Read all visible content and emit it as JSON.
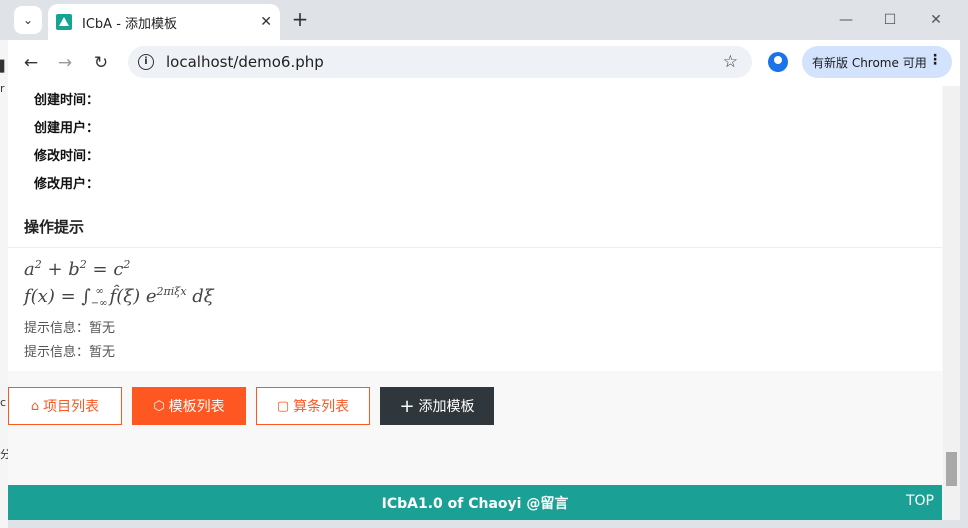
{
  "browser": {
    "tab_title": "ICbA - 添加模板",
    "url": "localhost/demo6.php",
    "update_label": "有新版 Chrome 可用",
    "controls": {
      "dropdown": "⌄",
      "close": "✕",
      "new_tab": "+",
      "minimize": "—",
      "maximize": "☐",
      "window_close": "✕",
      "back": "←",
      "forward": "→",
      "reload": "↻",
      "info": "i",
      "star": "☆",
      "menu": "⋮"
    }
  },
  "behind_page": {
    "left_chars": [
      "▌",
      "r",
      "c",
      "分"
    ]
  },
  "meta": [
    {
      "label": "创建时间："
    },
    {
      "label": "创建用户："
    },
    {
      "label": "修改时间："
    },
    {
      "label": "修改用户："
    }
  ],
  "section": {
    "title": "操作提示"
  },
  "formulas": {
    "line1": "a² + b² = c²",
    "line2": "f(x) = ∫₋∞^∞ f̂(ξ) e^{2πiξx} dξ"
  },
  "hints": [
    "提示信息：暂无",
    "提示信息：暂无"
  ],
  "buttons": [
    {
      "label": "项目列表",
      "icon": "home-icon",
      "glyph": "⌂"
    },
    {
      "label": "模板列表",
      "icon": "cube-icon",
      "glyph": "⬡"
    },
    {
      "label": "算条列表",
      "icon": "note-icon",
      "glyph": "▢"
    },
    {
      "label": "添加模板",
      "icon": "plus-icon",
      "glyph": "+"
    }
  ],
  "footer": {
    "text": "ICbA1.0 of Chaoyi @留言",
    "top_link": "TOP"
  },
  "colors": {
    "accent": "#ff5722",
    "footer": "#1aa094",
    "dark_button": "#2f363c"
  }
}
